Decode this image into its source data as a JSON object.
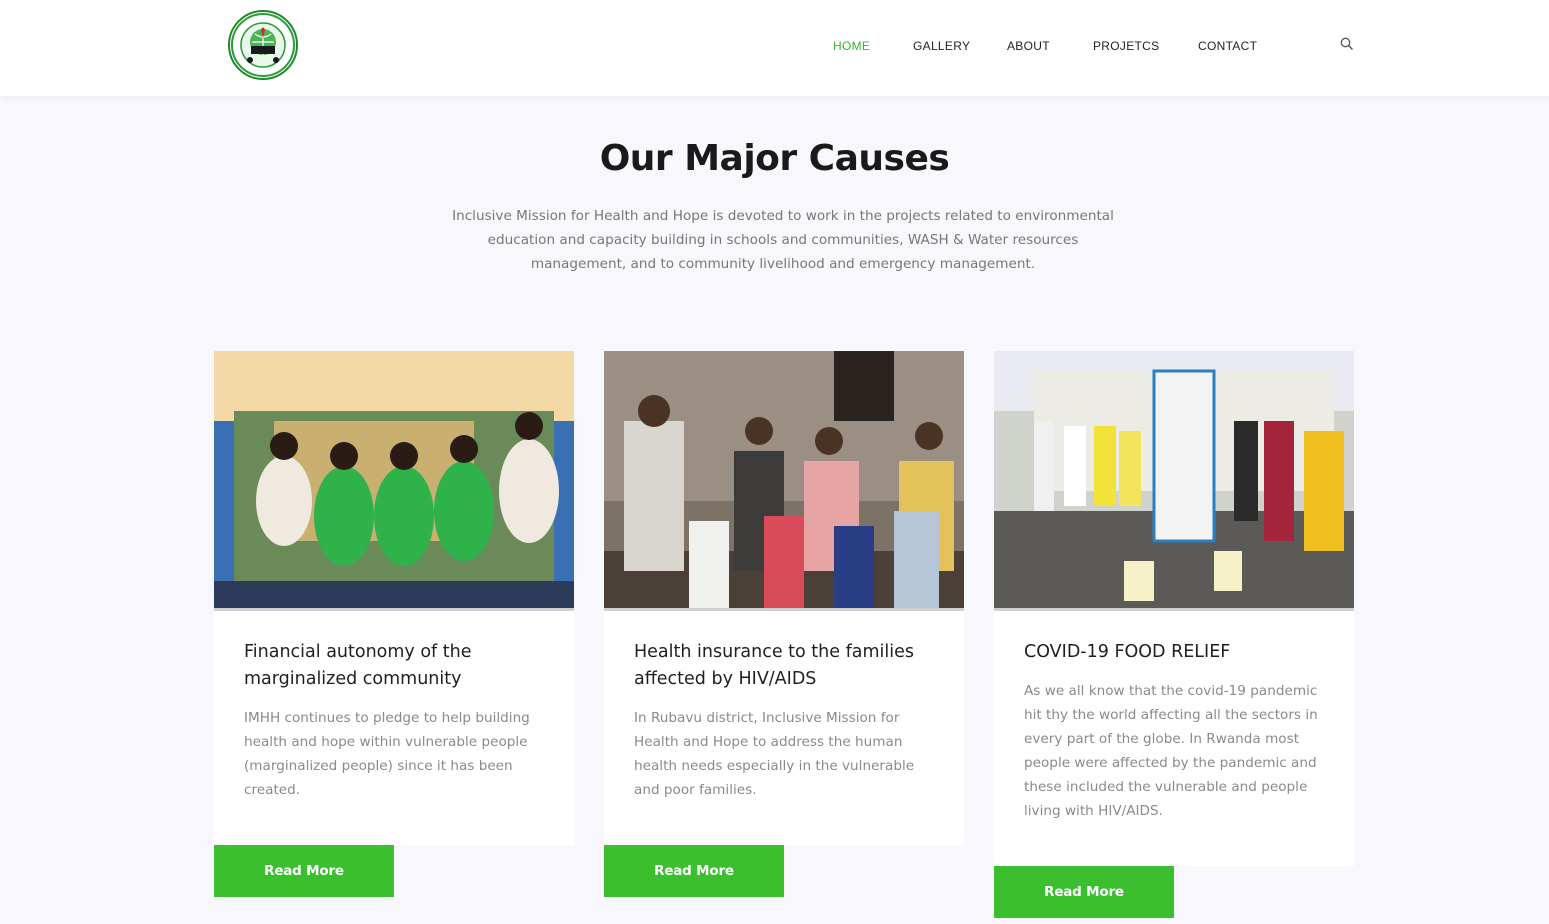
{
  "header": {
    "logo_alt": "Inclusive Mission for Health and Hope",
    "nav": [
      {
        "label": "HOME",
        "active": true
      },
      {
        "label": "GALLERY",
        "active": false
      },
      {
        "label": "ABOUT",
        "active": false
      },
      {
        "label": "PROJETCS",
        "active": false
      },
      {
        "label": "CONTACT",
        "active": false
      }
    ],
    "search_icon": "search-icon"
  },
  "section": {
    "title": "Our Major Causes",
    "intro": "Inclusive Mission for Health and Hope is devoted to work in the projects related to environmental education and capacity building in schools and communities, WASH & Water resources management, and to community livelihood and emergency management."
  },
  "causes": [
    {
      "title": "Financial autonomy of the marginalized community",
      "text": "IMHH continues to pledge to help building health and hope within vulnerable people (marginalized people) since it has been created.",
      "button": "Read More"
    },
    {
      "title": "Health insurance to the families affected by HIV/AIDS",
      "text": "In Rubavu district, Inclusive Mission for Health and Hope to address the human health needs especially in the vulnerable and poor families.",
      "button": "Read More"
    },
    {
      "title": "COVID-19 FOOD RELIEF",
      "text": "As we all know that the covid-19 pandemic hit thy the world affecting all the sectors in every part of the globe. In Rwanda most people were affected by the pandemic and these included the vulnerable and people living with HIV/AIDS.",
      "button": "Read More"
    }
  ],
  "colors": {
    "accent": "#3cbf2f",
    "nav_active": "#36b82e",
    "page_bg": "#f8f7fd"
  }
}
